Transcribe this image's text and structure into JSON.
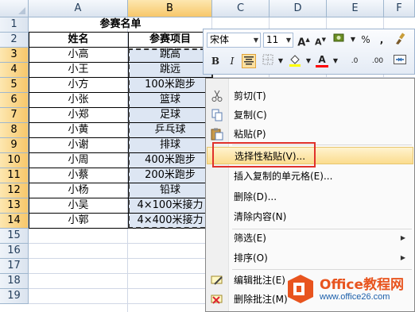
{
  "columns": [
    "A",
    "B",
    "C",
    "D",
    "E",
    "F"
  ],
  "rows": [
    "1",
    "2",
    "3",
    "4",
    "5",
    "6",
    "7",
    "8",
    "9",
    "10",
    "11",
    "12",
    "13",
    "14",
    "15",
    "16",
    "17",
    "18",
    "19"
  ],
  "table": {
    "title": "参赛名单",
    "headers": [
      "姓名",
      "参赛项目"
    ],
    "records": [
      [
        "小高",
        "跳高"
      ],
      [
        "小王",
        "跳远"
      ],
      [
        "小方",
        "100米跑步"
      ],
      [
        "小张",
        "篮球"
      ],
      [
        "小郑",
        "足球"
      ],
      [
        "小黄",
        "乒乓球"
      ],
      [
        "小谢",
        "排球"
      ],
      [
        "小周",
        "400米跑步"
      ],
      [
        "小蔡",
        "200米跑步"
      ],
      [
        "小杨",
        "铅球"
      ],
      [
        "小吴",
        "4×100米接力"
      ],
      [
        "小郭",
        "4×400米接力"
      ]
    ]
  },
  "mini_toolbar": {
    "font_name": "宋体",
    "font_size": "11",
    "grow_font": "A",
    "shrink_font": "A",
    "percent": "%",
    "comma": ",",
    "bold": "B",
    "italic": "I",
    "font_color_letter": "A",
    "decrease_decimal": ".00",
    "increase_decimal": ".0",
    "font_color": "#ff0000",
    "fill_color": "#ffff00"
  },
  "context_menu": {
    "items": [
      {
        "label": "剪切(T)",
        "icon": "scissors-icon"
      },
      {
        "label": "复制(C)",
        "icon": "copy-icon"
      },
      {
        "label": "粘贴(P)",
        "icon": "paste-icon"
      },
      {
        "label": "选择性粘贴(V)...",
        "highlighted": true
      },
      {
        "label": "插入复制的单元格(E)..."
      },
      {
        "label": "删除(D)..."
      },
      {
        "label": "清除内容(N)"
      },
      {
        "label": "筛选(E)",
        "submenu": true
      },
      {
        "label": "排序(O)",
        "submenu": true
      },
      {
        "label": "编辑批注(E)",
        "icon": "edit-comment-icon"
      },
      {
        "label": "删除批注(M)",
        "icon": "delete-comment-icon"
      }
    ]
  },
  "highlight_color": "#e0312b",
  "watermark": {
    "name": "Office教程网",
    "url": "www.office26.com"
  }
}
